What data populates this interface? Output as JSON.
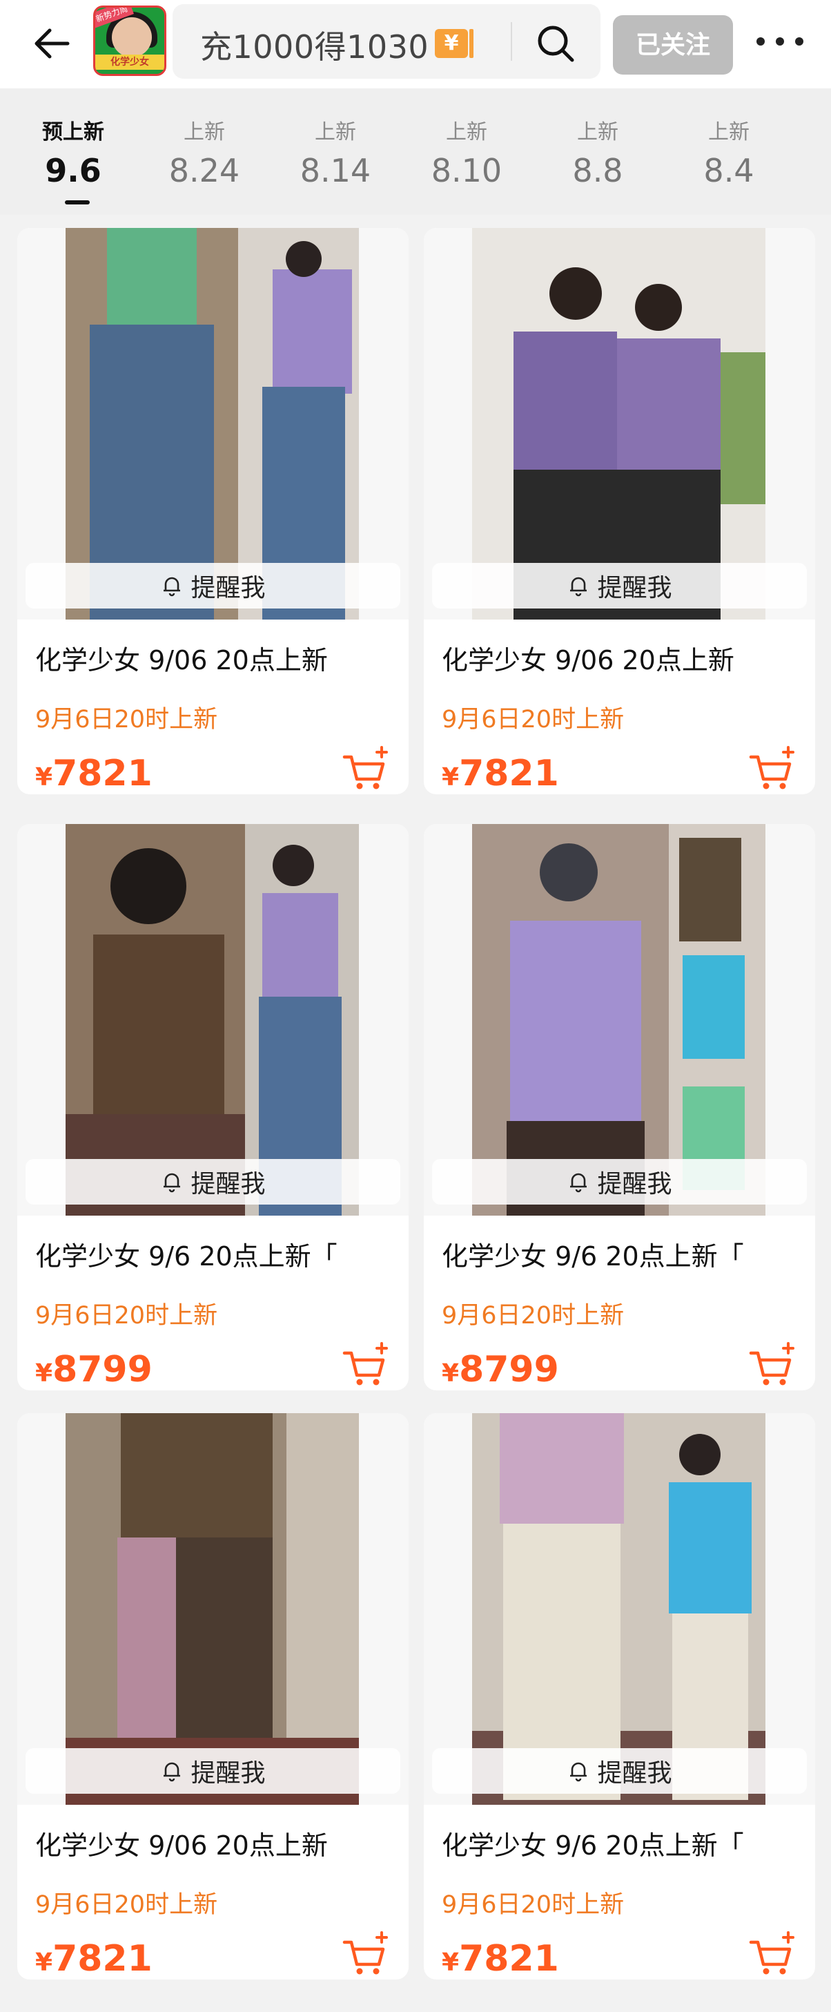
{
  "header": {
    "shop_logo": {
      "ribbon": "新势力周",
      "tag": "化学少女"
    },
    "search_text": "充1000得1030",
    "yen_badge": "¥",
    "follow_label": "已关注",
    "icons": {
      "back": "arrow-left-icon",
      "search": "search-icon",
      "more": "more-dots-icon"
    }
  },
  "tabs": [
    {
      "label": "预上新",
      "date": "9.6",
      "active": true
    },
    {
      "label": "上新",
      "date": "8.24"
    },
    {
      "label": "上新",
      "date": "8.14"
    },
    {
      "label": "上新",
      "date": "8.10"
    },
    {
      "label": "上新",
      "date": "8.8"
    },
    {
      "label": "上新",
      "date": "8.4"
    }
  ],
  "products": [
    {
      "remind": "提醒我",
      "title": "化学少女 9/06 20点上新",
      "sub": "9月6日20时上新",
      "currency": "¥",
      "price": "7821"
    },
    {
      "remind": "提醒我",
      "title": "化学少女 9/06 20点上新",
      "sub": "9月6日20时上新",
      "currency": "¥",
      "price": "7821"
    },
    {
      "remind": "提醒我",
      "title": "化学少女 9/6 20点上新「",
      "sub": "9月6日20时上新",
      "currency": "¥",
      "price": "8799"
    },
    {
      "remind": "提醒我",
      "title": "化学少女 9/6 20点上新「",
      "sub": "9月6日20时上新",
      "currency": "¥",
      "price": "8799"
    },
    {
      "remind": "提醒我",
      "title": "化学少女 9/06 20点上新",
      "sub": "9月6日20时上新",
      "currency": "¥",
      "price": "7821"
    },
    {
      "remind": "提醒我",
      "title": "化学少女 9/6 20点上新「",
      "sub": "9月6日20时上新",
      "currency": "¥",
      "price": "7821"
    }
  ],
  "colors": {
    "accent": "#ff5a1f",
    "subtitle": "#f07a22",
    "follow_bg": "#bdbdbd"
  }
}
